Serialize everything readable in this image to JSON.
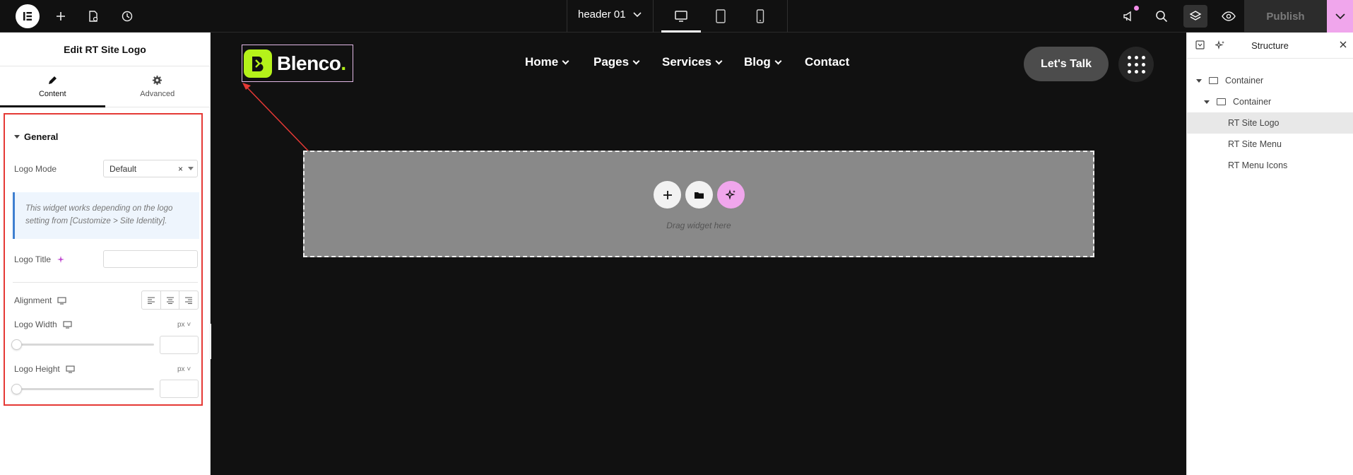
{
  "topbar": {
    "document_title": "header 01",
    "publish_label": "Publish"
  },
  "left_panel": {
    "title": "Edit RT Site Logo",
    "tabs": [
      {
        "label": "Content"
      },
      {
        "label": "Advanced"
      }
    ],
    "section_title": "General",
    "logo_mode": {
      "label": "Logo Mode",
      "value": "Default",
      "clear": "×"
    },
    "notice": "This widget works depending on the logo setting from [Customize > Site Identity].",
    "logo_title": {
      "label": "Logo Title",
      "value": ""
    },
    "alignment": {
      "label": "Alignment"
    },
    "logo_width": {
      "label": "Logo Width",
      "unit": "px",
      "value": ""
    },
    "logo_height": {
      "label": "Logo Height",
      "unit": "px",
      "value": ""
    }
  },
  "canvas": {
    "logo_text": "Blenco",
    "logo_dot": ".",
    "nav": [
      {
        "label": "Home",
        "dropdown": true
      },
      {
        "label": "Pages",
        "dropdown": true
      },
      {
        "label": "Services",
        "dropdown": true
      },
      {
        "label": "Blog",
        "dropdown": true
      },
      {
        "label": "Contact",
        "dropdown": false
      }
    ],
    "cta_label": "Let's Talk",
    "drop_zone_hint": "Drag widget here"
  },
  "right_panel": {
    "title": "Structure",
    "tree": [
      {
        "label": "Container",
        "level": 0
      },
      {
        "label": "Container",
        "level": 1
      },
      {
        "label": "RT Site Logo",
        "level": 2,
        "selected": true
      },
      {
        "label": "RT Site Menu",
        "level": 2
      },
      {
        "label": "RT Menu Icons",
        "level": 2
      }
    ]
  },
  "colors": {
    "accent_pink": "#f0a6ec",
    "highlight_red": "#e53935",
    "logo_lime": "#b5f21a",
    "notice_blue": "#3f7fd0"
  }
}
